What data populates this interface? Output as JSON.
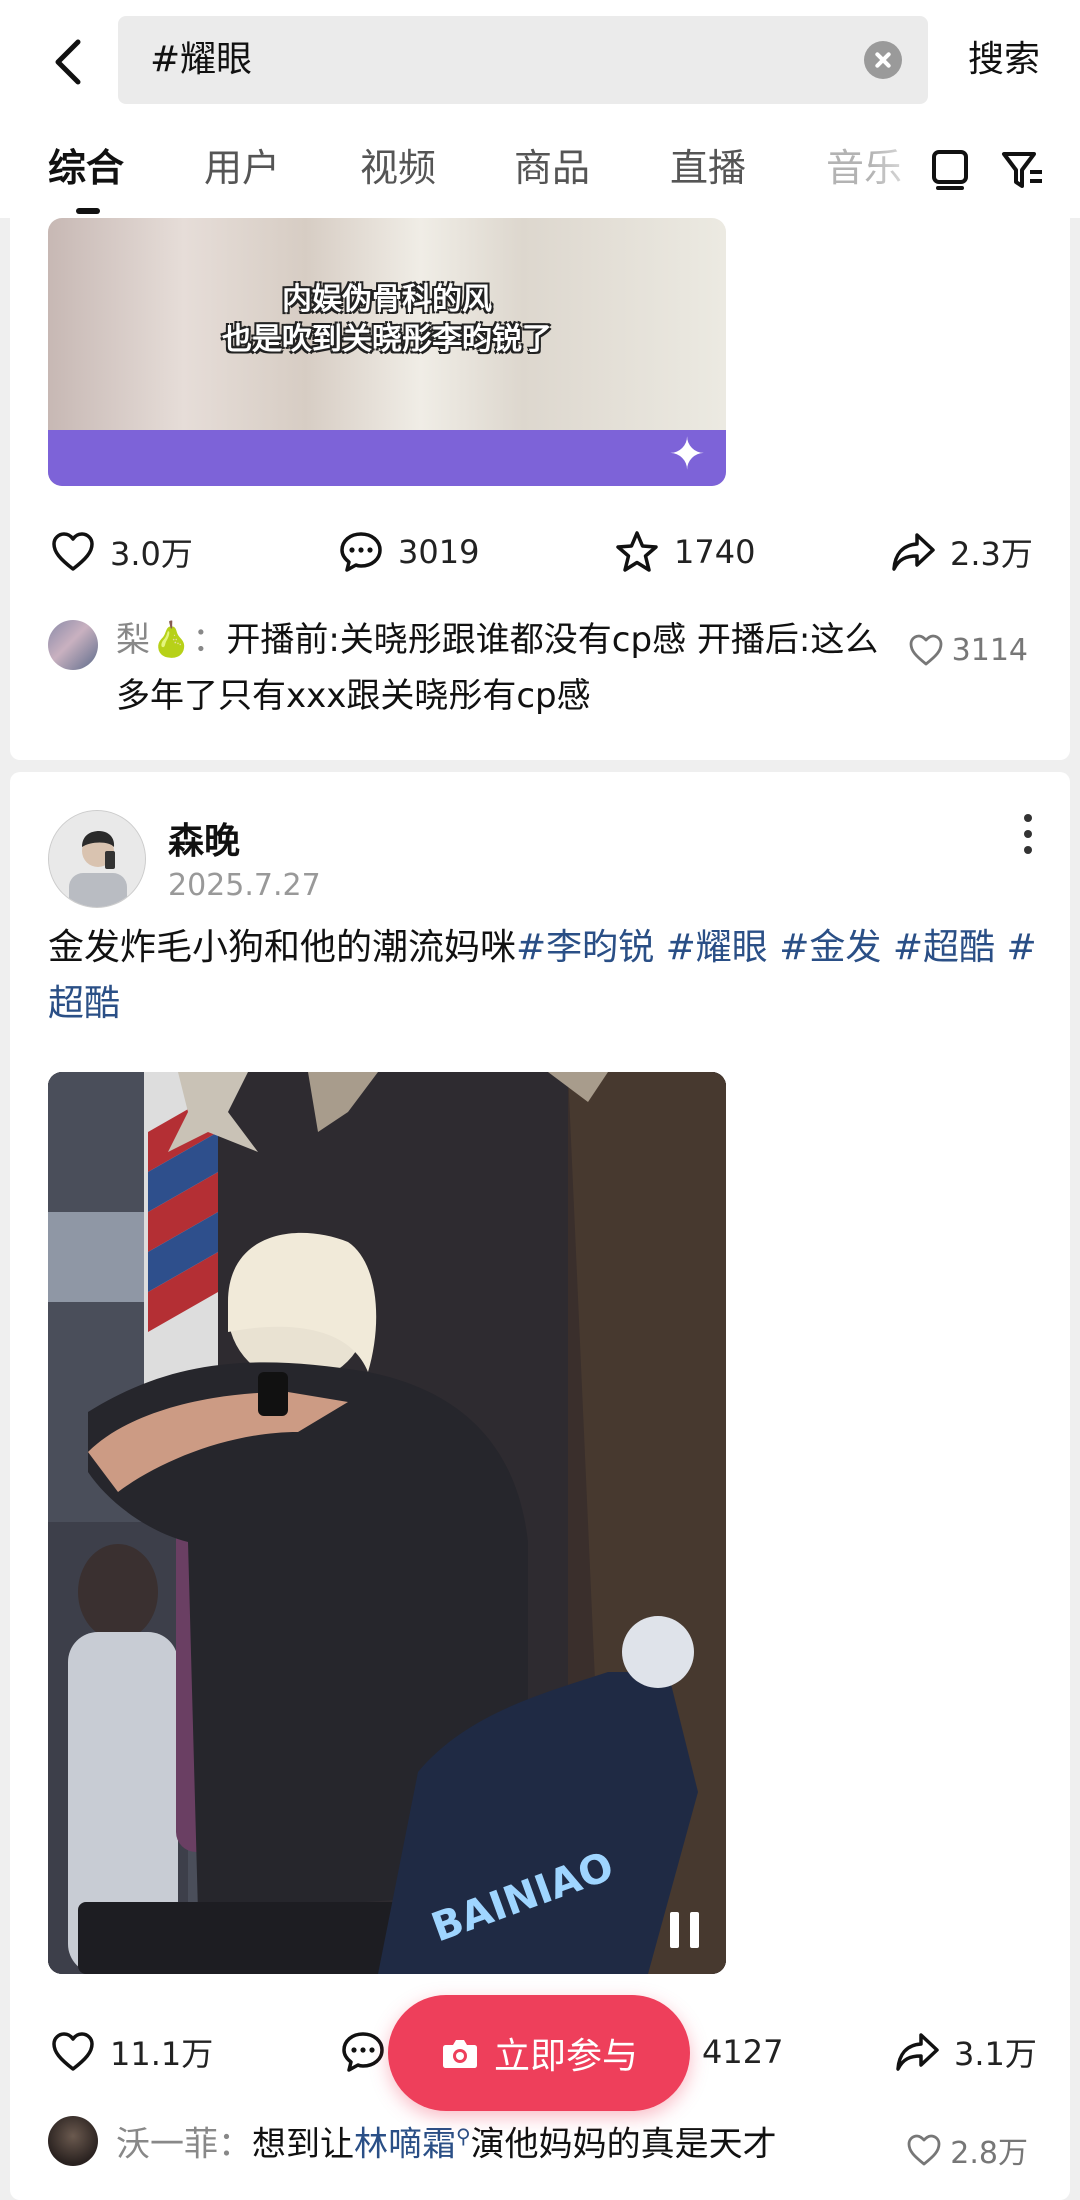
{
  "search": {
    "query": "#耀眼",
    "button_label": "搜索"
  },
  "tabs": [
    "综合",
    "用户",
    "视频",
    "商品",
    "直播",
    "音乐"
  ],
  "post1": {
    "thumbnail_caption_line1": "内娱伪骨科的风",
    "thumbnail_caption_line2": "也是吹到关晓彤李昀锐了",
    "likes": "3.0万",
    "comments": "3019",
    "favorites": "1740",
    "shares": "2.3万",
    "top_comment": {
      "name": "梨🍐",
      "sep": "：",
      "text": "开播前:关晓彤跟谁都没有cp感 开播后:这么多年了只有xxx跟关晓彤有cp感",
      "likes": "3114"
    }
  },
  "post2": {
    "author": "森晚",
    "date": "2025.7.27",
    "text_plain": "金发炸毛小狗和他的潮流妈咪",
    "hashtags": "#李昀锐 #耀眼 #金发 #超酷 #超酷",
    "video_watermark": "BAINIAO",
    "likes": "11.1万",
    "comments": "",
    "favorites": "4127",
    "shares": "3.1万",
    "top_comment": {
      "name": "沃一菲",
      "sep": "：",
      "text_before": "想到让",
      "link": "林嘀霜",
      "text_after": "演他妈妈的真是天才",
      "likes": "2.8万"
    }
  },
  "join_button": "立即参与",
  "colors": {
    "accent": "#ee3f5b",
    "hashtag": "#2a4f86",
    "background": "#efefef"
  }
}
